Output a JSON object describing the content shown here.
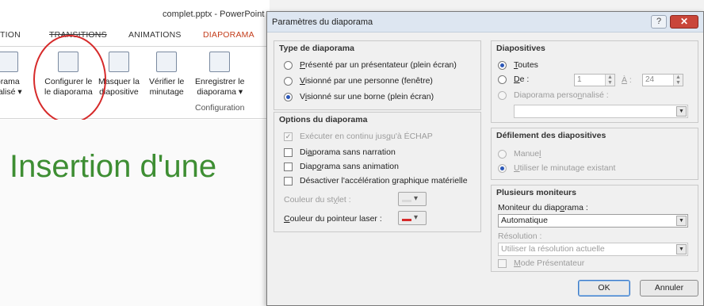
{
  "ppt": {
    "window_title": "complet.pptx - PowerPoint",
    "tabs": [
      "TION",
      "TRANSITIONS",
      "ANIMATIONS",
      "DIAPORAMA"
    ],
    "ribbon_buttons": [
      {
        "line1": "orama",
        "line2": "nalisé ▾"
      },
      {
        "line1": "Configurer le",
        "line2": "le diaporama"
      },
      {
        "line1": "Masquer la",
        "line2": "diapositive"
      },
      {
        "line1": "Vérifier le",
        "line2": "minutage"
      },
      {
        "line1": "Enregistrer le",
        "line2": "diaporama ▾"
      }
    ],
    "group_label": "Configuration",
    "slide_title": "Insertion d'une"
  },
  "dialog": {
    "title": "Paramètres du diaporama",
    "help": "?",
    "close": "✕",
    "type": {
      "heading": "Type de diaporama",
      "options": [
        {
          "pre": "",
          "u": "P",
          "post": "résenté par un présentateur (plein écran)",
          "selected": false
        },
        {
          "pre": "",
          "u": "V",
          "post": "isionné par une personne (fenêtre)",
          "selected": false
        },
        {
          "pre": "V",
          "u": "i",
          "post": "sionné sur une borne (plein écran)",
          "selected": true
        }
      ]
    },
    "options": {
      "heading": "Options du diaporama",
      "checks": [
        {
          "pre": "Exécuter en continu jus",
          "u": "q",
          "post": "u'à ÉCHAP",
          "checked": true,
          "disabled": true
        },
        {
          "pre": "Di",
          "u": "a",
          "post": "porama sans narration",
          "checked": false,
          "disabled": false
        },
        {
          "pre": "Diap",
          "u": "o",
          "post": "rama sans animation",
          "checked": false,
          "disabled": false
        },
        {
          "pre": "Désactiver l'accélération ",
          "u": "g",
          "post": "raphique matérielle",
          "checked": false,
          "disabled": false
        }
      ],
      "pen_color_label": "Couleur du st",
      "pen_color_u": "y",
      "pen_color_post": "let :",
      "laser_color_pre": "",
      "laser_color_u": "C",
      "laser_color_post": "ouleur du pointeur laser :"
    },
    "slides": {
      "heading": "Diapositives",
      "all_u": "T",
      "all_post": "outes",
      "from_u": "D",
      "from_post": "e :",
      "from_value": "1",
      "to_u": "À",
      "to_post": " :",
      "to_value": "24",
      "custom_pre": "Diaporama perso",
      "custom_u": "n",
      "custom_post": "nalisé :",
      "selected": "all"
    },
    "advance": {
      "heading": "Défilement des diapositives",
      "manual_pre": "Manue",
      "manual_u": "l",
      "manual_post": "",
      "timing_u": "U",
      "timing_post": "tiliser le minutage existant"
    },
    "monitors": {
      "heading": "Plusieurs moniteurs",
      "monitor_pre": "Moniteur du diap",
      "monitor_u": "o",
      "monitor_post": "rama :",
      "monitor_value": "Automatique",
      "resolution_label": "Résolution :",
      "resolution_value": "Utiliser la résolution actuelle",
      "presenter_pre": "",
      "presenter_u": "M",
      "presenter_post": "ode Présentateur"
    },
    "ok": "OK",
    "cancel": "Annuler"
  }
}
